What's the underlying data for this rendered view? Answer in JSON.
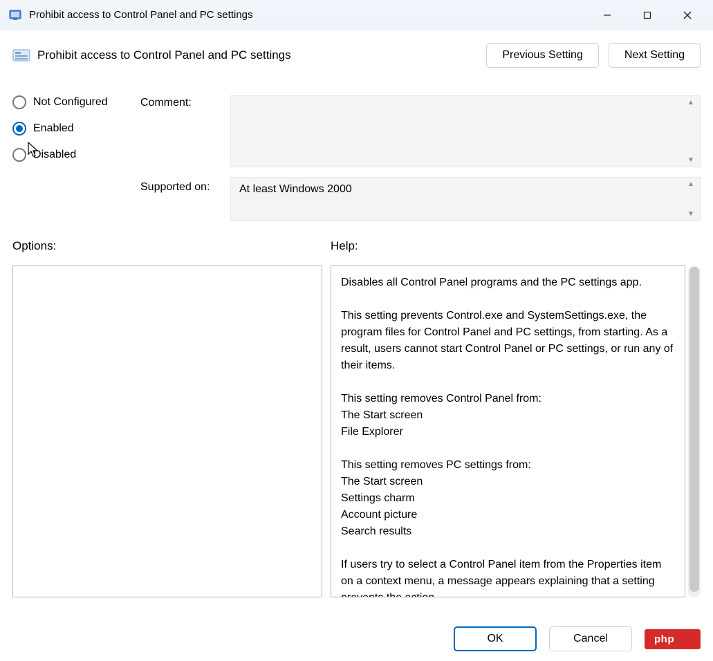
{
  "window": {
    "title": "Prohibit access to Control Panel and PC settings"
  },
  "header": {
    "policy_title": "Prohibit access to Control Panel and PC settings",
    "previous_label": "Previous Setting",
    "next_label": "Next Setting"
  },
  "state": {
    "not_configured": "Not Configured",
    "enabled": "Enabled",
    "disabled": "Disabled",
    "selected": "enabled"
  },
  "labels": {
    "comment": "Comment:",
    "supported_on": "Supported on:",
    "options": "Options:",
    "help": "Help:"
  },
  "supported_on_text": "At least Windows 2000",
  "help_text": {
    "l1": "Disables all Control Panel programs and the PC settings app.",
    "l2": "This setting prevents Control.exe and SystemSettings.exe, the program files for Control Panel and PC settings, from starting. As a result, users cannot start Control Panel or PC settings, or run any of their items.",
    "l3": "This setting removes Control Panel from:",
    "l4": "The Start screen",
    "l5": "File Explorer",
    "l6": "This setting removes PC settings from:",
    "l7": "The Start screen",
    "l8": "Settings charm",
    "l9": "Account picture",
    "l10": "Search results",
    "l11": "If users try to select a Control Panel item from the Properties item on a context menu, a message appears explaining that a setting prevents the action."
  },
  "footer": {
    "ok": "OK",
    "cancel": "Cancel",
    "badge": "php"
  }
}
